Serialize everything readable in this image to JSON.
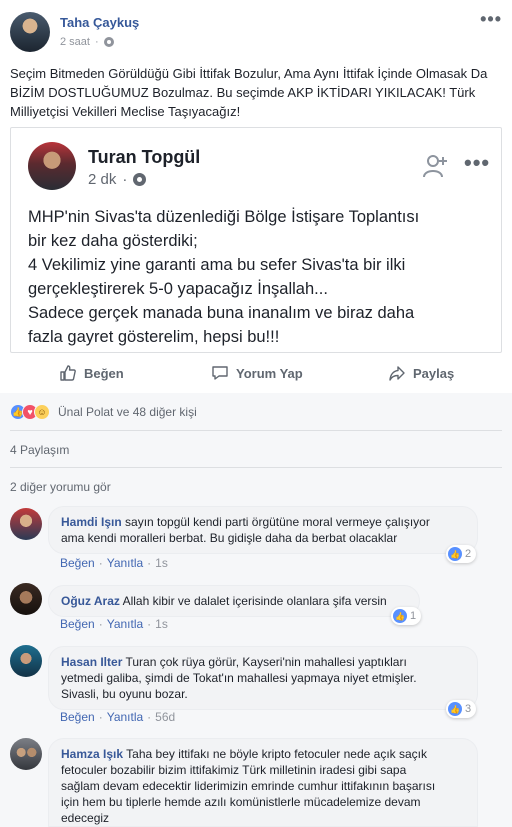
{
  "post": {
    "author": "Taha Çaykuş",
    "time": "2 saat",
    "text": "Seçim Bitmeden Görüldüğü Gibi İttifak Bozulur, Ama Aynı İttifak İçinde Olmasak Da BİZİM DOSTLUĞUMUZ Bozulmaz. Bu seçimde AKP İKTİDARI YIKILACAK! Türk Milliyetçisi Vekilleri Meclise Taşıyacağız!"
  },
  "shared": {
    "author": "Turan Topgül",
    "time": "2 dk",
    "text_lines": [
      "MHP'nin Sivas'ta düzenlediği Bölge İstişare Toplantısı",
      "bir kez daha gösterdiki;",
      "4 Vekilimiz yine garanti ama bu sefer Sivas'ta bir ilki",
      "gerçekleştirerek 5-0 yapacağız İnşallah...",
      "Sadece gerçek manada buna inanalım ve biraz daha",
      "fazla gayret gösterelim, hepsi bu!!!"
    ]
  },
  "actions": {
    "like": "Beğen",
    "comment": "Yorum Yap",
    "share": "Paylaş"
  },
  "reactions_summary": "Ünal Polat ve 48 diğer kişi",
  "shares_text": "4 Paylaşım",
  "more_comments": "2 diğer yorumu gör",
  "comment_actions": {
    "like": "Beğen",
    "reply": "Yanıtla"
  },
  "comments": [
    {
      "name": "Hamdi Işın",
      "lines": [
        "sayın topgül kendi parti örgütüne moral vermeye çalışıyor",
        "ama kendi moralleri berbat. Bu gidişle daha da berbat olacaklar"
      ],
      "time": "1s",
      "reactions": "2"
    },
    {
      "name": "Oğuz Araz",
      "lines": [
        "Allah kibir ve dalalet içerisinde olanlara şifa versin"
      ],
      "time": "1s",
      "reactions": "1"
    },
    {
      "name": "Hasan Ilter",
      "lines": [
        "Turan çok rüya görür, Kayseri'nin mahallesi yaptıkları",
        "yetmedi galiba, şimdi de Tokat'ın mahallesi yapmaya niyet etmişler.",
        "Sivasli, bu oyunu bozar."
      ],
      "time": "56d",
      "reactions": "3"
    },
    {
      "name": "Hamza Işık",
      "lines": [
        "Taha bey ittifakı ne böyle kripto fetoculer nede açık saçık",
        "fetoculer bozabilir bizim ittifakimiz Türk milletinin iradesi gibi sapa",
        "sağlam devam edecektir liderimizin emrinde cumhur ittifakının başarısı",
        "için hem bu tiplerle hemde azılı komünistlerle mücadelemize devam",
        "edecegiz"
      ]
    }
  ],
  "colors": {
    "link": "#365899",
    "like_blue": "#5890ff",
    "love_red": "#f25268",
    "haha_yellow": "#fcd05b",
    "muted": "#90949c"
  }
}
